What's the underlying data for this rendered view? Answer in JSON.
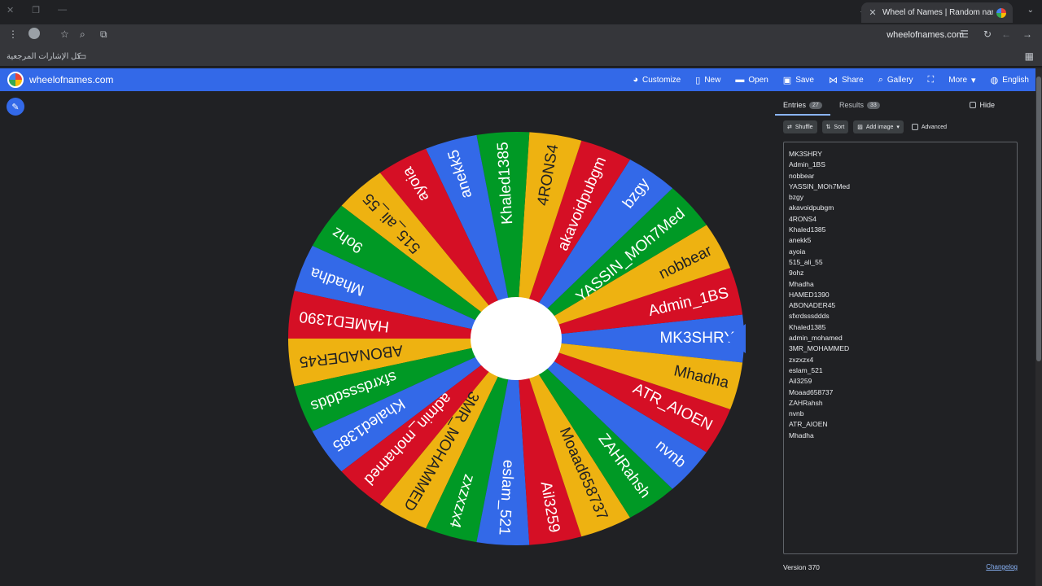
{
  "browser": {
    "tab_title": "Wheel of Names | Random nam",
    "url": "wheelofnames.com",
    "bookmarks_label": "كل الإشارات المرجعية"
  },
  "app": {
    "site_name": "wheelofnames.com",
    "menu": [
      {
        "label": "Customize",
        "icon": "palette-icon"
      },
      {
        "label": "New",
        "icon": "file-icon"
      },
      {
        "label": "Open",
        "icon": "folder-icon"
      },
      {
        "label": "Save",
        "icon": "save-icon"
      },
      {
        "label": "Share",
        "icon": "share-icon"
      },
      {
        "label": "Gallery",
        "icon": "search-icon"
      },
      {
        "label": "",
        "icon": "fullscreen-icon"
      },
      {
        "label": "More",
        "icon": "chevron-down-icon"
      },
      {
        "label": "English",
        "icon": "globe-icon"
      }
    ]
  },
  "wheel": {
    "colors": [
      "#3369e8",
      "#d50f25",
      "#eeb211",
      "#009925"
    ],
    "pointer_color": "#3369e8",
    "segments": [
      "MK3SHRY",
      "Admin_1BS",
      "nobbear",
      "YASSIN_MOh7Med",
      "bzgy",
      "akavoidpubgm",
      "4RONS4",
      "Khaled1385",
      "anekk5",
      "ayoia",
      "515_ali_55",
      "9ohz",
      "Mhadha",
      "HAMED1390",
      "ABONADER45",
      "sfxrdsssddds",
      "Khaled1385",
      "admin_mohamed",
      "3MR_MOHAMMED",
      "zxzxzx4",
      "eslam_521",
      "Ail3259",
      "Moaad658737",
      "ZAHRahsh",
      "nvnb",
      "ATR_AIOEN",
      "Mhadha"
    ]
  },
  "panel": {
    "entries_tab": "Entries",
    "entries_count": "27",
    "results_tab": "Results",
    "results_count": "33",
    "hide_label": "Hide",
    "shuffle_label": "Shuffle",
    "sort_label": "Sort",
    "add_image_label": "Add image",
    "advanced_label": "Advanced",
    "entries": [
      "MK3SHRY",
      "Admin_1BS",
      "nobbear",
      "YASSIN_MOh7Med",
      "bzgy",
      "akavoidpubgm",
      "4RONS4",
      "Khaled1385",
      "anekk5",
      "ayoia",
      "515_ali_55",
      "9ohz",
      "Mhadha",
      "HAMED1390",
      "ABONADER45",
      "sfxrdsssddds",
      "Khaled1385",
      "admin_mohamed",
      "3MR_MOHAMMED",
      "zxzxzx4",
      "eslam_521",
      "Ail3259",
      "Moaad658737",
      "ZAHRahsh",
      "nvnb",
      "ATR_AIOEN",
      "Mhadha"
    ],
    "version": "Version 370",
    "changelog": "Changelog"
  }
}
